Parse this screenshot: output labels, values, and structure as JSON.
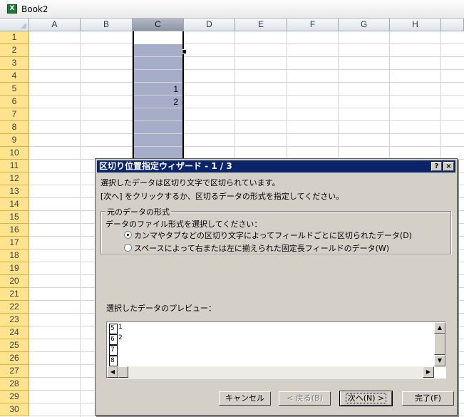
{
  "window": {
    "title": "Book2",
    "icon": "excel-workbook-icon"
  },
  "sheet": {
    "columns": [
      "A",
      "B",
      "C",
      "D",
      "E",
      "F",
      "G",
      "H"
    ],
    "selected_column": "C",
    "rows": [
      "1",
      "2",
      "3",
      "4",
      "5",
      "6",
      "7",
      "8",
      "9",
      "10",
      "11",
      "12",
      "13",
      "14",
      "15",
      "16",
      "17",
      "18",
      "19",
      "20",
      "21",
      "22",
      "23",
      "24",
      "25",
      "26",
      "27",
      "28",
      "29",
      "30"
    ],
    "cells": [
      {
        "ref": "C5",
        "row": 5,
        "value": "1"
      },
      {
        "ref": "C6",
        "row": 6,
        "value": "2"
      }
    ]
  },
  "dialog": {
    "title": "区切り位置指定ウィザード - 1 / 3",
    "help_button": "?",
    "close_button": "×",
    "line1": "選択したデータは区切り文字で区切られています。",
    "line2": "[次へ] をクリックするか、区切るデータの形式を指定してください。",
    "group_label": "元のデータの形式",
    "group_prompt": "データのファイル形式を選択してください：",
    "option_delimited": "カンマやタブなどの区切り文字によってフィールドごとに区切られたデータ(D)",
    "option_fixed": "スペースによって右または左に揃えられた固定長フィールドのデータ(W)",
    "selected_option": "delimited",
    "preview_label": "選択したデータのプレビュー：",
    "preview_rows": [
      {
        "num": "5",
        "value": "1"
      },
      {
        "num": "6",
        "value": "2"
      },
      {
        "num": "7",
        "value": ""
      },
      {
        "num": "8",
        "value": ""
      }
    ],
    "buttons": {
      "cancel": "キャンセル",
      "back": "< 戻る(B)",
      "next": "次へ(N) >",
      "finish": "完了(F)"
    }
  }
}
